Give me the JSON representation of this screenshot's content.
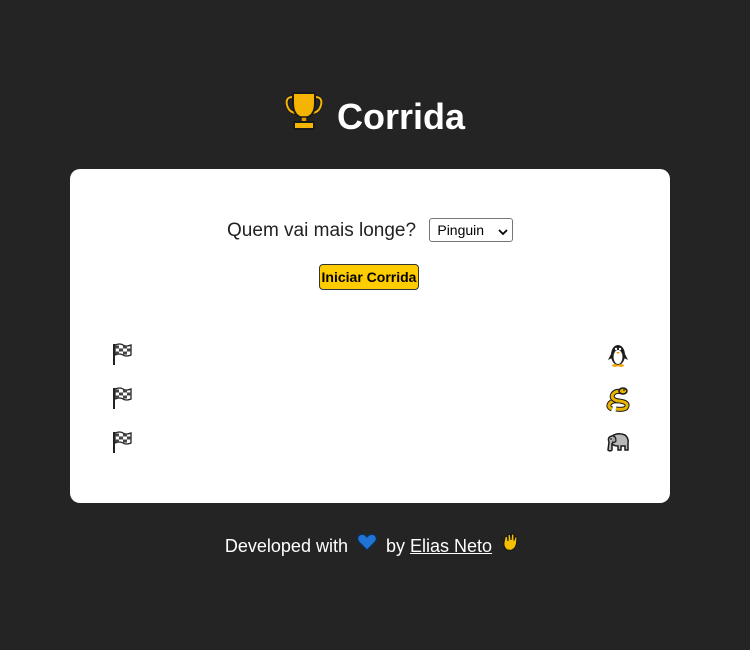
{
  "header": {
    "title": "Corrida",
    "icon": "trophy-icon"
  },
  "form": {
    "question": "Quem vai mais longe?",
    "select_value": "Pinguin",
    "start_button": "Iniciar Corrida"
  },
  "race": {
    "lanes": [
      {
        "start_icon": "checkered-flag-icon",
        "racer_icon": "penguin-icon"
      },
      {
        "start_icon": "checkered-flag-icon",
        "racer_icon": "snake-icon"
      },
      {
        "start_icon": "checkered-flag-icon",
        "racer_icon": "elephant-icon"
      }
    ]
  },
  "footer": {
    "prefix": "Developed with",
    "heart_icon": "blue-heart-icon",
    "by": "by",
    "author": "Elias Neto",
    "wave_icon": "waving-hand-icon"
  },
  "colors": {
    "background": "#242424",
    "card": "#ffffff",
    "button": "#ffcc00",
    "heart": "#1f74d4"
  }
}
